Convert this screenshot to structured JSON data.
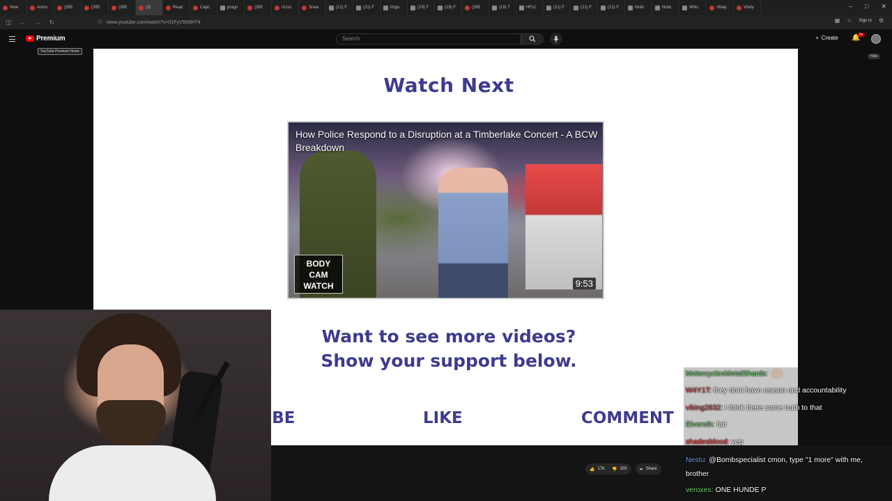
{
  "browser": {
    "tabs": [
      {
        "label": "New",
        "icon": "youtube-icon"
      },
      {
        "label": "Asmo",
        "icon": "youtube-icon"
      },
      {
        "label": "(395",
        "icon": "youtube-icon"
      },
      {
        "label": "(395",
        "icon": "youtube-icon"
      },
      {
        "label": "(395",
        "icon": "youtube-icon"
      },
      {
        "label": "(3)",
        "icon": "youtube-icon",
        "active": true
      },
      {
        "label": "Read",
        "icon": "youtube-icon"
      },
      {
        "label": "Capc",
        "icon": "youtube-icon"
      },
      {
        "label": "pragn",
        "icon": "globe-icon"
      },
      {
        "label": "(395",
        "icon": "youtube-icon"
      },
      {
        "label": "r/Livs",
        "icon": "reddit-icon"
      },
      {
        "label": "Snea",
        "icon": "youtube-icon"
      },
      {
        "label": "(21) F",
        "icon": "x-icon"
      },
      {
        "label": "(21) F",
        "icon": "x-icon"
      },
      {
        "label": "Imgu",
        "icon": "globe-icon"
      },
      {
        "label": "(19) F",
        "icon": "x-icon"
      },
      {
        "label": "(19) F",
        "icon": "x-icon"
      },
      {
        "label": "(395",
        "icon": "youtube-icon"
      },
      {
        "label": "(19) T",
        "icon": "x-icon"
      },
      {
        "label": "HFs1",
        "icon": "x-icon"
      },
      {
        "label": "(21) F",
        "icon": "x-icon"
      },
      {
        "label": "(21) F",
        "icon": "x-icon"
      },
      {
        "label": "(21) F",
        "icon": "x-icon"
      },
      {
        "label": "Notic",
        "icon": "globe-icon"
      },
      {
        "label": "Notic",
        "icon": "globe-icon"
      },
      {
        "label": "Whic",
        "icon": "globe-icon"
      },
      {
        "label": "Vitaly",
        "icon": "youtube-icon"
      },
      {
        "label": "Vitaly",
        "icon": "youtube-icon"
      }
    ],
    "url": "www.youtube.com/watch?v=01FyV5N9HT4",
    "signin": "Sign in"
  },
  "youtube": {
    "logo_text": "Premium",
    "logo_tooltip": "YouTube Premium Home",
    "search_placeholder": "Search",
    "create_label": "Create",
    "notif_badge": "9+",
    "hide_label": "Hide"
  },
  "video": {
    "watch_next": "Watch Next",
    "thumbnail_title": "How Police Respond to a Disruption at a Timberlake Concert - A BCW Breakdown",
    "thumbnail_badge_lines": [
      "BODY",
      "CAM",
      "WATCH"
    ],
    "thumbnail_duration": "9:53",
    "support_line1": "Want to see more videos?",
    "support_line2": "Show your support below.",
    "cta_subscribe": "RIBE",
    "cta_like": "LIKE",
    "cta_comment": "COMMENT"
  },
  "actions": {
    "likes": "17K",
    "dislikes": "305",
    "share": "Share"
  },
  "chat": [
    {
      "user": "MotorcyclesMetalShards:",
      "user_color": "#6fd06f",
      "text": ""
    },
    {
      "user": "W4Y1T:",
      "user_color": "#e04545",
      "text": "they dont have reason and accountability"
    },
    {
      "user": "viking2832:",
      "user_color": "#e04545",
      "text": "I think there some truth to that"
    },
    {
      "user": "Elvoroth:",
      "user_color": "#6fd06f",
      "text": "fair"
    },
    {
      "user": "shadesblood:",
      "user_color": "#e04545",
      "text": "yep"
    },
    {
      "user": "Nestu:",
      "user_color": "#6f9be0",
      "text": "@Bombspecialist cmon, type \"1 more\" with me, brother"
    },
    {
      "user": "veroxes:",
      "user_color": "#6fd06f",
      "text": "ONE HUNDE P"
    }
  ]
}
